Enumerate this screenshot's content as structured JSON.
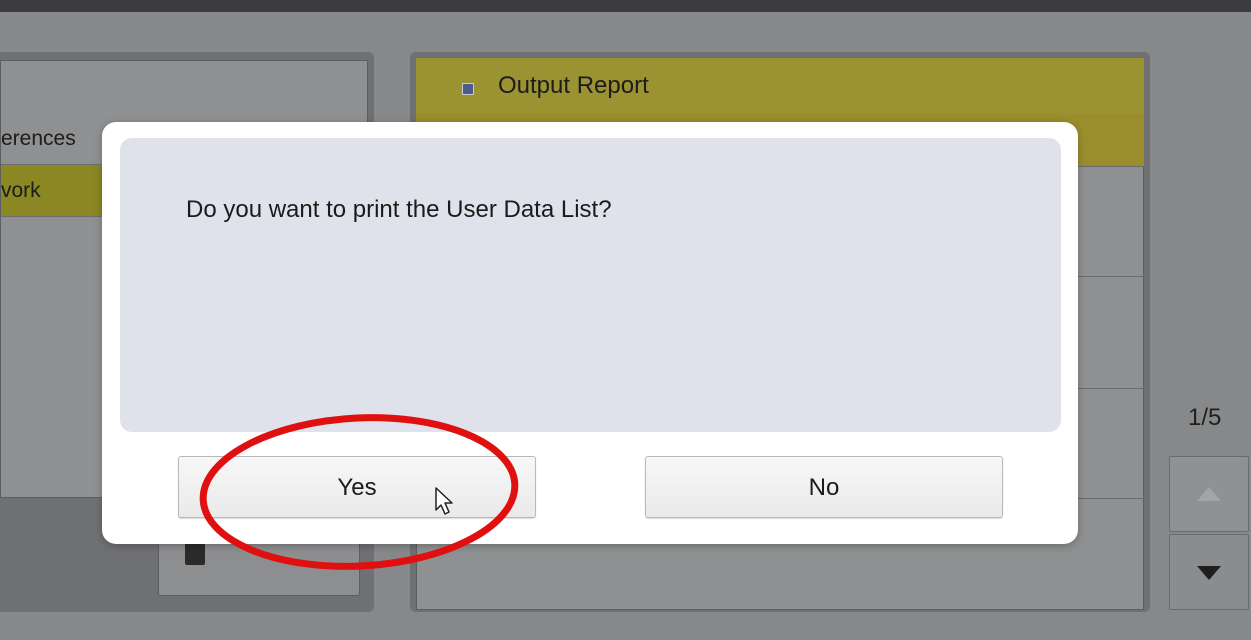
{
  "left_panel": {
    "rows": [
      "erences",
      "vork"
    ],
    "selected_index": 1
  },
  "right_panel": {
    "header_title": "Output Report"
  },
  "pager": {
    "page_indicator": "1/5",
    "up_icon": "arrow-up-icon",
    "down_icon": "arrow-down-icon"
  },
  "dialog": {
    "message": "Do you want to print the User Data List?",
    "yes_label": "Yes",
    "no_label": "No"
  },
  "annotation": {
    "ring_color": "#e01010",
    "target": "Yes"
  },
  "colors": {
    "selected_row": "#8b8722",
    "header_bg": "#9b9232",
    "dialog_message_bg": "#dfe2ea"
  }
}
